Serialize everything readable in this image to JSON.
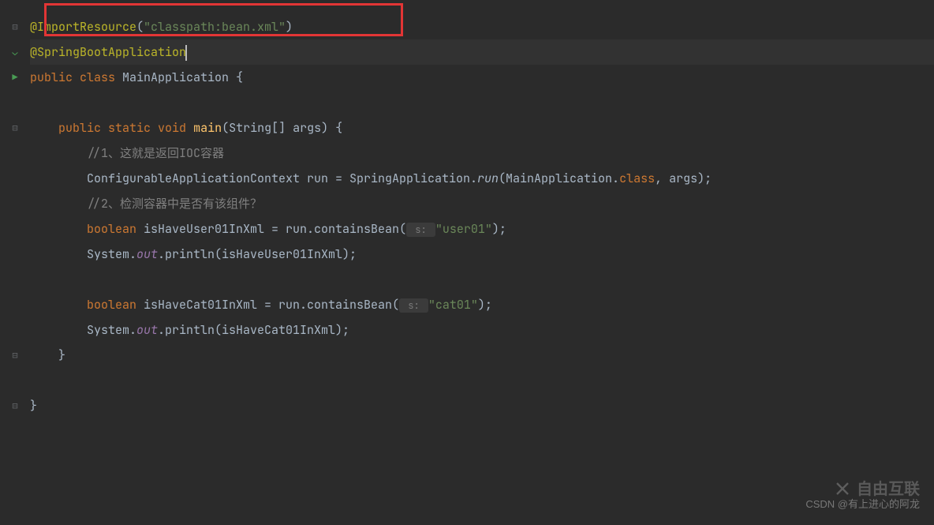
{
  "code": {
    "line1": {
      "annotation": "@ImportResource",
      "paren_open": "(",
      "string": "\"classpath:bean.xml\"",
      "paren_close": ")"
    },
    "line2": {
      "annotation": "@SpringBootApplication"
    },
    "line3": {
      "kw_public": "public ",
      "kw_class": "class ",
      "classname": "MainApplication ",
      "brace": "{"
    },
    "line5": {
      "indent": "    ",
      "kw_public": "public ",
      "kw_static": "static ",
      "kw_void": "void ",
      "method": "main",
      "params": "(String[] args) {"
    },
    "line6": {
      "indent": "        ",
      "comment": "//1、这就是返回IOC容器"
    },
    "line7": {
      "indent": "        ",
      "type": "ConfigurableApplicationContext run = SpringApplication.",
      "run": "run",
      "paren": "(MainApplication.",
      "class_kw": "class",
      "rest": ", args);"
    },
    "line8": {
      "indent": "        ",
      "comment": "//2、检测容器中是否有该组件？"
    },
    "line9": {
      "indent": "        ",
      "kw_boolean": "boolean ",
      "var": "isHaveUser01InXml = run.containsBean(",
      "hint": " s: ",
      "string": "\"user01\"",
      "rest": ");"
    },
    "line10": {
      "indent": "        ",
      "sys": "System.",
      "out": "out",
      "rest1": ".println(isHaveUser01InXml);"
    },
    "line12": {
      "indent": "        ",
      "kw_boolean": "boolean ",
      "var": "isHaveCat01InXml = run.containsBean(",
      "hint": " s: ",
      "string": "\"cat01\"",
      "rest": ");"
    },
    "line13": {
      "indent": "        ",
      "sys": "System.",
      "out": "out",
      "rest1": ".println(isHaveCat01InXml);"
    },
    "line14": {
      "indent": "    ",
      "brace": "}"
    },
    "line16": {
      "brace": "}"
    }
  },
  "watermark": {
    "logo": "自由互联",
    "credit": "CSDN @有上进心的阿龙"
  }
}
